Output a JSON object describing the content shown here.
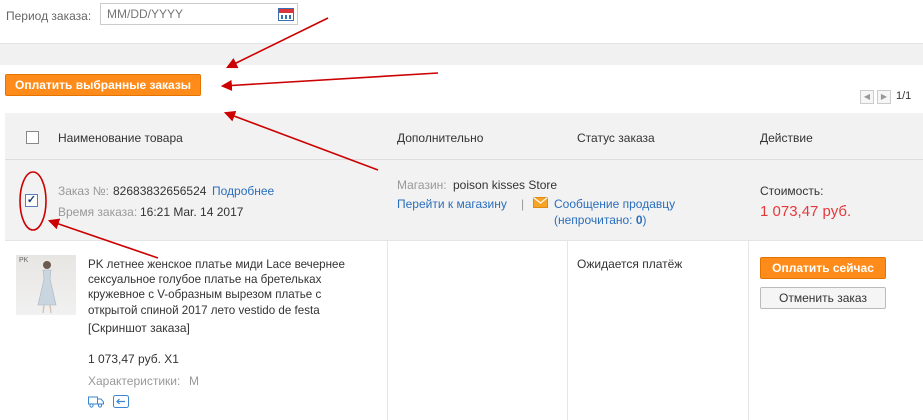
{
  "filter": {
    "period_label": "Период заказа:",
    "date_placeholder": "MM/DD/YYYY",
    "calendar_icon": "calendar-icon"
  },
  "actions": {
    "pay_selected_label": "Оплатить выбранные заказы"
  },
  "pager": {
    "prev_icon": "◀",
    "next_icon": "▶",
    "page_count": "1/1"
  },
  "table_header": {
    "product_name": "Наименование товара",
    "additional": "Дополнительно",
    "order_status": "Статус заказа",
    "action": "Действие"
  },
  "order": {
    "number_label": "Заказ №:",
    "number": "82683832656524",
    "details_link": "Подробнее",
    "time_label": "Время заказа:",
    "time": "16:21 Mar. 14 2017",
    "store_label": "Магазин:",
    "store_name": "poison kisses Store",
    "go_to_store": "Перейти к магазину",
    "separator": "|",
    "message_seller": "Сообщение продавцу",
    "unread_prefix": "(непрочитано: ",
    "unread_count": "0",
    "unread_suffix": ")",
    "cost_label": "Стоимость:",
    "cost": "1 073,47 руб.",
    "checked": true
  },
  "product": {
    "thumbnail_badge": "PK",
    "title": "PK летнее женское платье миди Lace вечернее сексуальное голубое платье на бретельках кружевное с V-образным вырезом платье с открытой спиной 2017 лето vestido de festa",
    "screenshot_link": "[Скриншот заказа]",
    "price_qty": "1 073,47 руб. X1",
    "characteristics_label": "Характеристики:",
    "characteristics_value": "M",
    "status": "Ожидается платёж",
    "pay_now": "Оплатить сейчас",
    "cancel_order": "Отменить заказ"
  },
  "colors": {
    "accent_orange": "#ff8c1a",
    "price_red": "#e4393c",
    "link_blue": "#2a6ebb",
    "annotation_red": "#cc0000"
  }
}
